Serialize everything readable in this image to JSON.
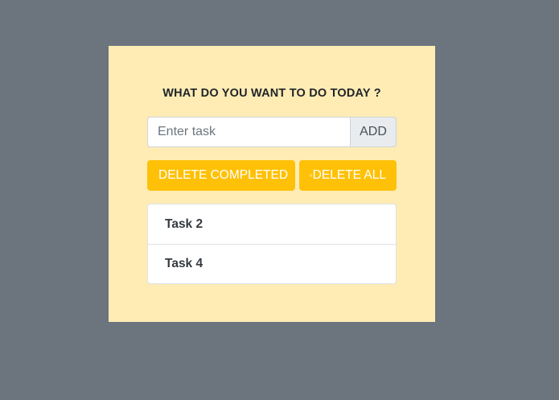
{
  "card": {
    "title": "WHAT DO YOU WANT TO DO TODAY ?"
  },
  "task_input": {
    "placeholder": "Enter task",
    "value": ""
  },
  "add_button": {
    "label": "ADD"
  },
  "actions": {
    "delete_completed_label": "DELETE COMPLETED",
    "delete_all_label": "DELETE ALL",
    "icon": "trash-icon"
  },
  "tasks": [
    {
      "label": "Task 2"
    },
    {
      "label": "Task 4"
    }
  ],
  "colors": {
    "background": "#6c757d",
    "card": "#ffecb5",
    "warning": "#ffc107"
  }
}
